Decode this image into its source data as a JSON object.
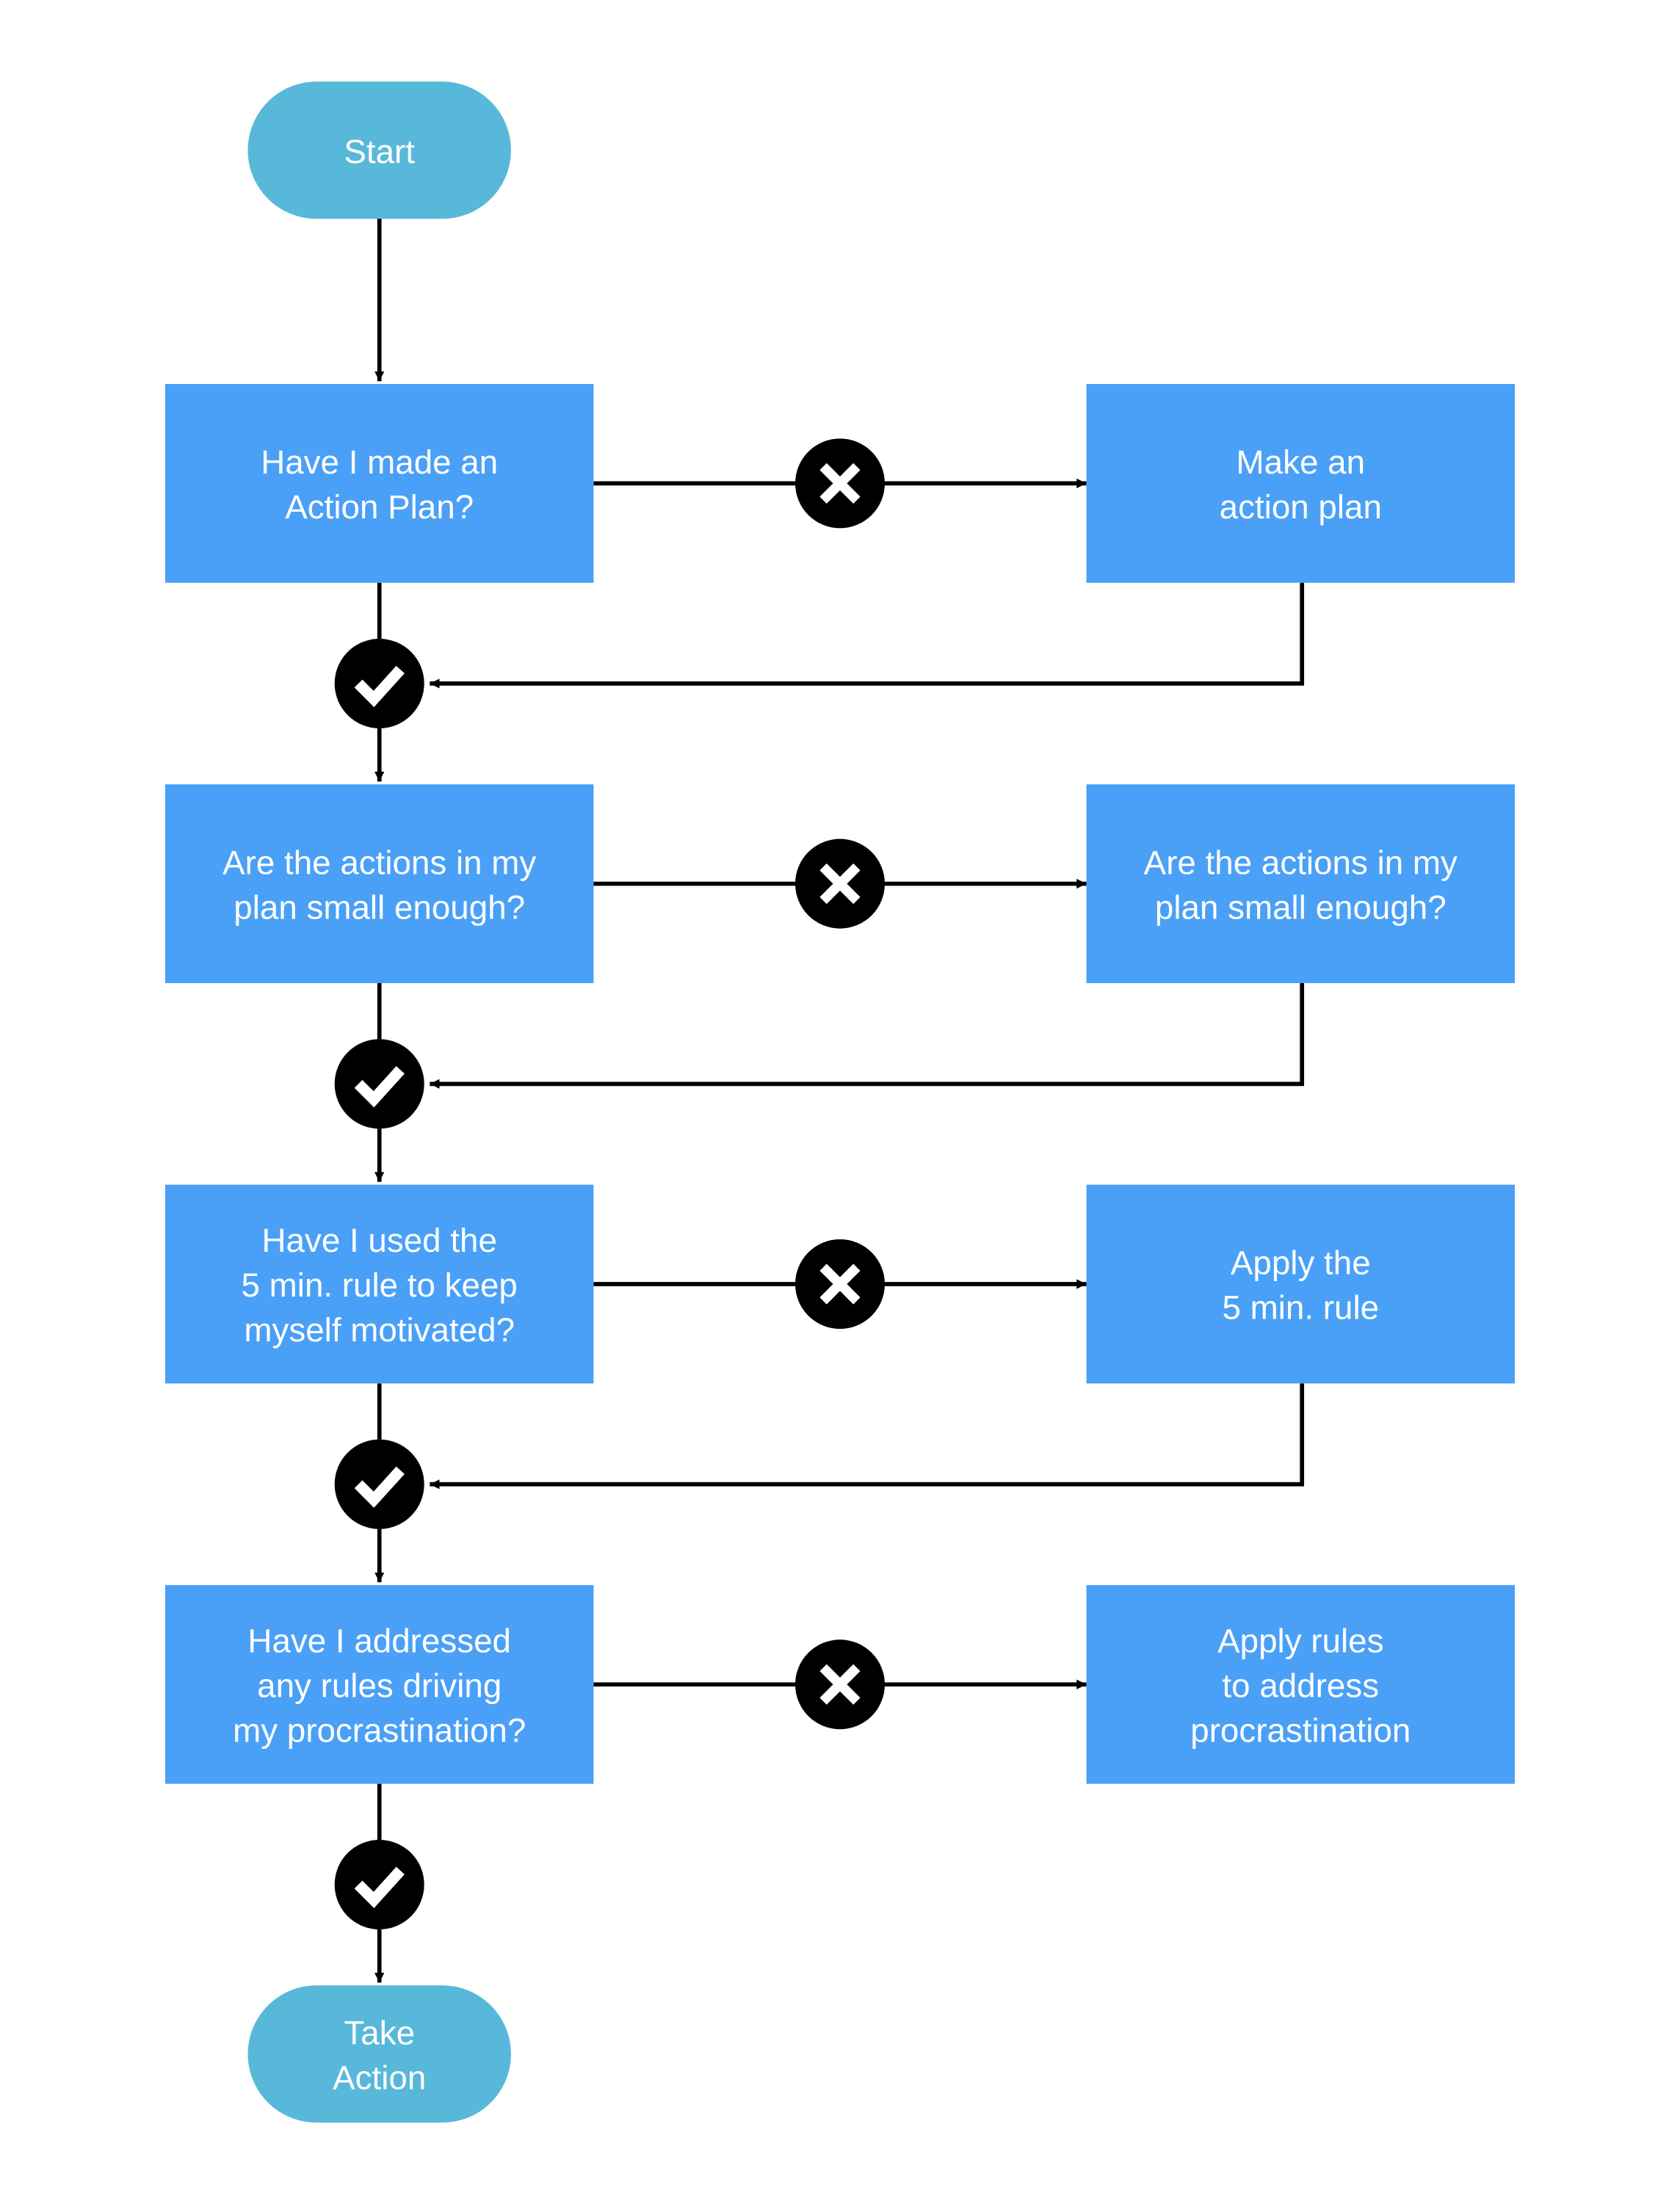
{
  "diagram": {
    "type": "flowchart",
    "colors": {
      "terminal": "#58B8D9",
      "process": "#4AA0F7",
      "connector": "#000000",
      "text": "#ffffff",
      "background": "#ffffff"
    },
    "start": {
      "id": "start",
      "lines": [
        "Start"
      ]
    },
    "end": {
      "id": "end",
      "lines": [
        "Take",
        "Action"
      ]
    },
    "steps": [
      {
        "question": {
          "id": "q1",
          "lines": [
            "Have I made an",
            "Action Plan?"
          ]
        },
        "no_action": {
          "id": "a1",
          "lines": [
            "Make an",
            "action plan"
          ]
        },
        "no_label": "no-icon",
        "yes_label": "yes-icon",
        "returns": true
      },
      {
        "question": {
          "id": "q2",
          "lines": [
            "Are the actions in my",
            "plan small enough?"
          ]
        },
        "no_action": {
          "id": "a2",
          "lines": [
            "Are the actions in my",
            "plan small enough?"
          ]
        },
        "no_label": "no-icon",
        "yes_label": "yes-icon",
        "returns": true
      },
      {
        "question": {
          "id": "q3",
          "lines": [
            "Have I used the",
            "5 min. rule to keep",
            "myself motivated?"
          ]
        },
        "no_action": {
          "id": "a3",
          "lines": [
            "Apply the",
            "5 min. rule"
          ]
        },
        "no_label": "no-icon",
        "yes_label": "yes-icon",
        "returns": true
      },
      {
        "question": {
          "id": "q4",
          "lines": [
            "Have I addressed",
            "any rules driving",
            "my procrastination?"
          ]
        },
        "no_action": {
          "id": "a4",
          "lines": [
            "Apply rules",
            "to address",
            "procrastination"
          ]
        },
        "no_label": "no-icon",
        "yes_label": "yes-icon",
        "returns": false
      }
    ]
  }
}
